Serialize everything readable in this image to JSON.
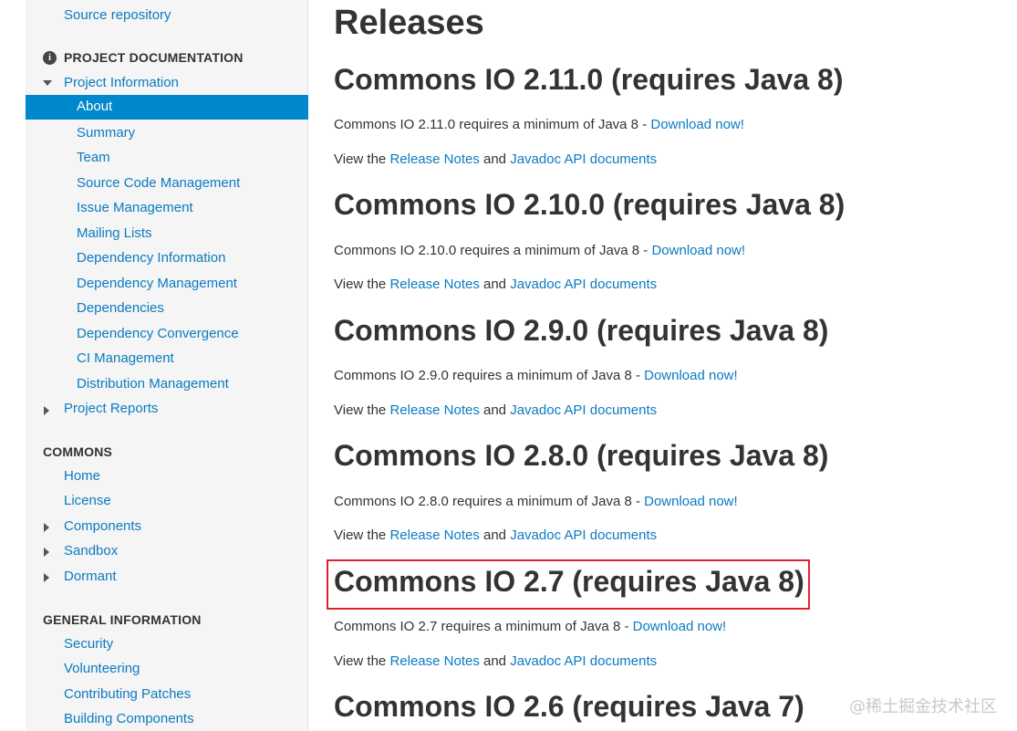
{
  "sidebar": {
    "source_repository": "Source repository",
    "project_documentation_header": "PROJECT DOCUMENTATION",
    "project_information": "Project Information",
    "project_information_items": [
      "About",
      "Summary",
      "Team",
      "Source Code Management",
      "Issue Management",
      "Mailing Lists",
      "Dependency Information",
      "Dependency Management",
      "Dependencies",
      "Dependency Convergence",
      "CI Management",
      "Distribution Management"
    ],
    "project_reports": "Project Reports",
    "commons_header": "COMMONS",
    "commons_items": [
      "Home",
      "License",
      "Components",
      "Sandbox",
      "Dormant"
    ],
    "general_information_header": "GENERAL INFORMATION",
    "general_information_items": [
      "Security",
      "Volunteering",
      "Contributing Patches",
      "Building Components"
    ]
  },
  "main": {
    "title": "Releases",
    "releases": [
      {
        "heading": "Commons IO 2.11.0 (requires Java 8)",
        "requires_text": "Commons IO 2.11.0 requires a minimum of Java 8 - ",
        "download": "Download now!"
      },
      {
        "heading": "Commons IO 2.10.0 (requires Java 8)",
        "requires_text": "Commons IO 2.10.0 requires a minimum of Java 8 - ",
        "download": "Download now!"
      },
      {
        "heading": "Commons IO 2.9.0 (requires Java 8)",
        "requires_text": "Commons IO 2.9.0 requires a minimum of Java 8 - ",
        "download": "Download now!"
      },
      {
        "heading": "Commons IO 2.8.0 (requires Java 8)",
        "requires_text": "Commons IO 2.8.0 requires a minimum of Java 8 - ",
        "download": "Download now!"
      },
      {
        "heading": "Commons IO 2.7 (requires Java 8)",
        "requires_text": "Commons IO 2.7 requires a minimum of Java 8 - ",
        "download": "Download now!"
      },
      {
        "heading": "Commons IO 2.6 (requires Java 7)"
      }
    ],
    "view_prefix": "View the ",
    "release_notes": "Release Notes",
    "and_text": " and ",
    "javadoc": "Javadoc API documents"
  },
  "watermark": "@稀土掘金技术社区",
  "colors": {
    "link": "#0a7bc0",
    "active_bg": "#0088cc",
    "sidebar_bg": "#f5f5f5",
    "highlight_border": "#e0232a"
  }
}
